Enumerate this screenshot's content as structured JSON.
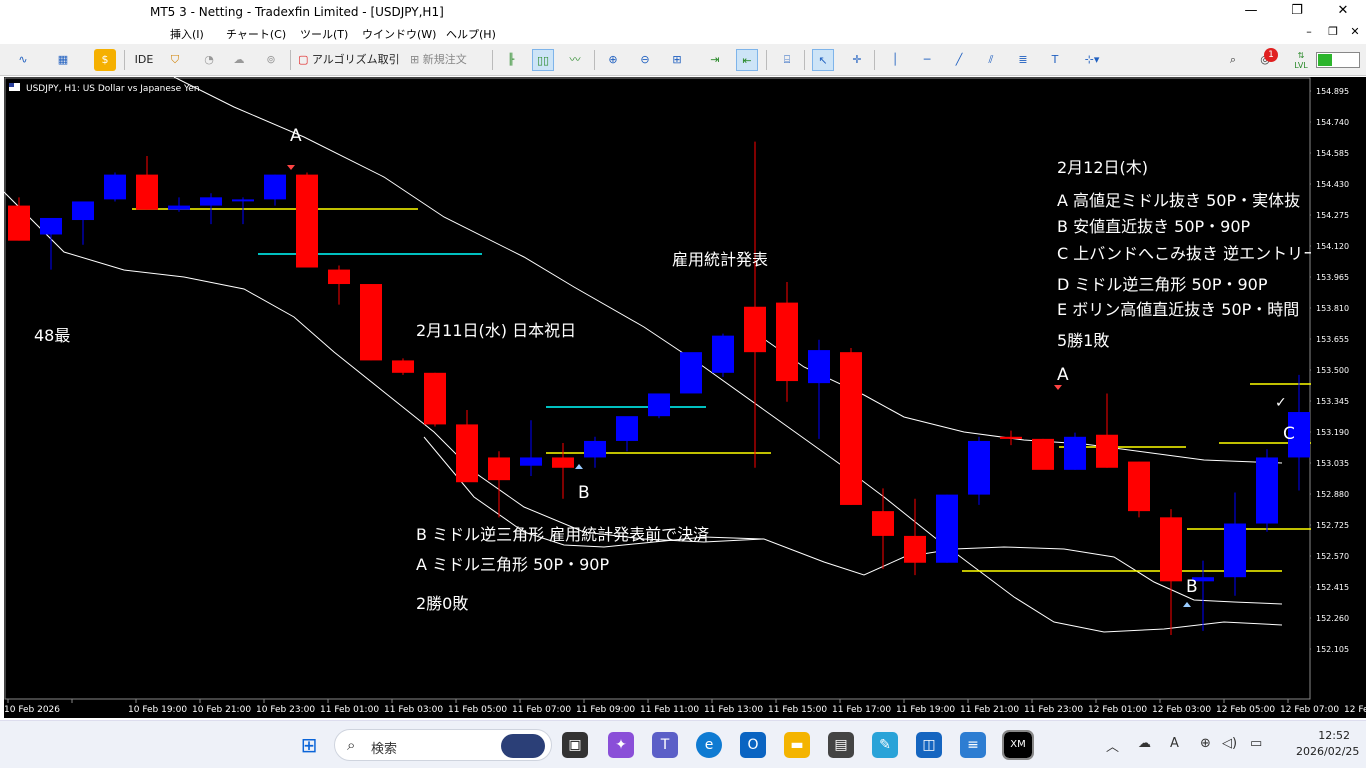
{
  "window": {
    "title": "MT5 3 - Netting - Tradexfin Limited - [USDJPY,H1]",
    "minimize": "—",
    "maximize": "❐",
    "close": "✕"
  },
  "menu": {
    "items": [
      "挿入(I)",
      "チャート(C)",
      "ツール(T)",
      "ウインドウ(W)",
      "ヘルプ(H)"
    ]
  },
  "toolbar": {
    "ide": "IDE",
    "algo": "アルゴリズム取引",
    "new_order": "新規注文",
    "notify_count": "1",
    "lvl": "LVL"
  },
  "chart": {
    "header": "USDJPY, H1:  US Dollar vs Japanese Yen",
    "price_labels": [
      "154.895",
      "154.740",
      "154.585",
      "154.430",
      "154.275",
      "154.120",
      "153.965",
      "153.810",
      "153.655",
      "153.500",
      "153.345",
      "153.190",
      "153.035",
      "152.880",
      "152.725",
      "152.570",
      "152.415",
      "152.260",
      "152.105"
    ],
    "time_labels": [
      "10 Feb 2026",
      "10 Feb 19:00",
      "10 Feb 21:00",
      "10 Feb 23:00",
      "11 Feb 01:00",
      "11 Feb 03:00",
      "11 Feb 05:00",
      "11 Feb 07:00",
      "11 Feb 09:00",
      "11 Feb 11:00",
      "11 Feb 13:00",
      "11 Feb 15:00",
      "11 Feb 17:00",
      "11 Feb 19:00",
      "11 Feb 21:00",
      "11 Feb 23:00",
      "12 Feb 01:00",
      "12 Feb 03:00",
      "12 Feb 05:00",
      "12 Feb 07:00",
      "12 Feb 09:00"
    ],
    "colors": {
      "bull": "#0000ff",
      "bear": "#ff0000",
      "band": "#ffffff",
      "yellow": "#ffff00",
      "cyan": "#00ffff"
    },
    "annotations": {
      "note48": "48最",
      "jobs": "雇用統計発表",
      "d11_title": "2月11日(水)  日本祝日",
      "d11_b": "B  ミドル逆三角形  雇用統計発表前で決済",
      "d11_a": "A  ミドル三角形  50P・90P",
      "d11_result": "2勝0敗",
      "d12_title": "2月12日(木)",
      "d12_a": "A  高値足ミドル抜き  50P・実体抜",
      "d12_b": "B  安値直近抜き  50P・90P",
      "d12_c": "C  上バンドへこみ抜き  逆エントリー",
      "d12_d": "D  ミドル逆三角形  50P・90P",
      "d12_e": "E  ボリン高値直近抜き  50P・時間",
      "d12_result": "5勝1敗",
      "markA1": "A",
      "markB1": "B",
      "markA2": "A",
      "markB2": "B",
      "markC": "C",
      "check": "✓"
    }
  },
  "chart_data": {
    "type": "candlestick",
    "symbol": "USDJPY",
    "timeframe": "H1",
    "y_range": [
      152.105,
      154.895
    ],
    "x_labels": [
      "10 Feb 2026",
      "10 Feb 19:00",
      "10 Feb 21:00",
      "10 Feb 23:00",
      "11 Feb 01:00",
      "11 Feb 03:00",
      "11 Feb 05:00",
      "11 Feb 07:00",
      "11 Feb 09:00",
      "11 Feb 11:00",
      "11 Feb 13:00",
      "11 Feb 15:00",
      "11 Feb 17:00",
      "11 Feb 19:00",
      "11 Feb 21:00",
      "11 Feb 23:00",
      "12 Feb 01:00",
      "12 Feb 03:00",
      "12 Feb 05:00",
      "12 Feb 07:00",
      "12 Feb 09:00"
    ],
    "ohlc": [
      [
        154.34,
        154.38,
        154.17,
        154.17
      ],
      [
        154.2,
        154.21,
        154.03,
        154.28
      ],
      [
        154.27,
        154.36,
        154.15,
        154.36
      ],
      [
        154.37,
        154.5,
        154.36,
        154.49
      ],
      [
        154.49,
        154.58,
        154.32,
        154.32
      ],
      [
        154.32,
        154.38,
        154.31,
        154.34
      ],
      [
        154.34,
        154.4,
        154.25,
        154.38
      ],
      [
        154.37,
        154.38,
        154.25,
        154.37
      ],
      [
        154.37,
        154.49,
        154.34,
        154.49
      ],
      [
        154.49,
        154.5,
        154.04,
        154.04
      ],
      [
        154.03,
        154.05,
        153.86,
        153.96
      ],
      [
        153.96,
        153.96,
        153.59,
        153.59
      ],
      [
        153.59,
        153.6,
        153.52,
        153.53
      ],
      [
        153.53,
        153.53,
        153.27,
        153.28
      ],
      [
        153.28,
        153.35,
        153.01,
        153.0
      ],
      [
        153.12,
        153.15,
        152.83,
        153.01
      ],
      [
        153.08,
        153.3,
        153.03,
        153.12
      ],
      [
        153.12,
        153.19,
        152.92,
        153.07
      ],
      [
        153.12,
        153.22,
        153.07,
        153.2
      ],
      [
        153.2,
        153.27,
        153.15,
        153.32
      ],
      [
        153.32,
        153.43,
        153.31,
        153.43
      ],
      [
        153.43,
        153.56,
        153.45,
        153.63
      ],
      [
        153.53,
        153.72,
        153.51,
        153.71
      ],
      [
        153.85,
        154.65,
        153.07,
        153.63
      ],
      [
        153.87,
        153.97,
        153.39,
        153.49
      ],
      [
        153.48,
        153.69,
        153.21,
        153.64
      ],
      [
        153.63,
        153.65,
        152.89,
        152.89
      ],
      [
        152.86,
        152.97,
        152.58,
        152.74
      ],
      [
        152.74,
        152.92,
        152.55,
        152.61
      ],
      [
        152.61,
        152.94,
        152.61,
        152.94
      ],
      [
        152.94,
        153.22,
        152.89,
        153.2
      ],
      [
        153.22,
        153.25,
        153.18,
        153.21
      ],
      [
        153.21,
        153.21,
        153.07,
        153.06
      ],
      [
        153.06,
        153.24,
        153.06,
        153.22
      ],
      [
        153.23,
        153.43,
        153.07,
        153.07
      ],
      [
        153.1,
        153.1,
        152.83,
        152.86
      ],
      [
        152.83,
        152.87,
        152.26,
        152.52
      ],
      [
        152.52,
        152.62,
        152.28,
        152.54
      ],
      [
        152.54,
        152.95,
        152.45,
        152.8
      ],
      [
        152.8,
        153.16,
        152.76,
        153.12
      ],
      [
        153.12,
        153.52,
        152.96,
        153.34
      ],
      [
        153.34,
        153.41,
        152.85,
        153.06
      ]
    ]
  }
}
